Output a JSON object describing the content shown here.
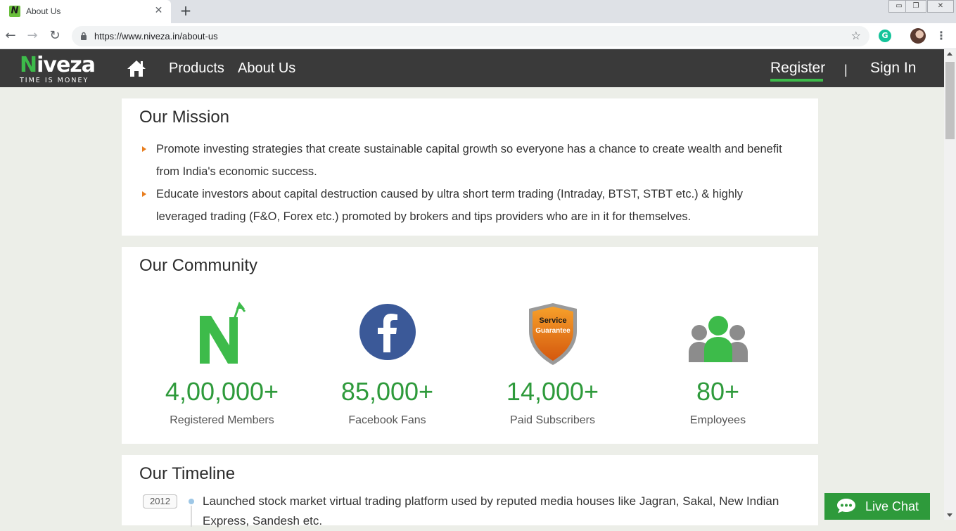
{
  "browser": {
    "tab_title": "About Us",
    "tab_favicon_letter": "N",
    "tab_close": "✕",
    "new_tab": "+",
    "url": "https://www.niveza.in/about-us",
    "controls": {
      "minimize": "▭",
      "restore": "❐",
      "close": "✕"
    }
  },
  "header": {
    "logo_first": "N",
    "logo_rest": "iveza",
    "logo_tagline": "TIME IS MONEY",
    "nav": [
      {
        "label": "Products"
      },
      {
        "label": "About Us"
      }
    ],
    "register_label": "Register",
    "separator": "|",
    "signin_label": "Sign In"
  },
  "mission": {
    "title": "Our Mission",
    "bullets": [
      "Promote investing strategies that create sustainable capital growth so everyone has a chance to create wealth and benefit from India's economic success.",
      "Educate investors about capital destruction caused by ultra short term trading (Intraday, BTST, STBT etc.) & highly leveraged trading (F&O, Forex etc.) promoted by brokers and tips providers who are in it for themselves."
    ]
  },
  "community": {
    "title": "Our Community",
    "stats": [
      {
        "icon": "niveza-n-icon",
        "value": "4,00,000+",
        "label": "Registered Members"
      },
      {
        "icon": "facebook-icon",
        "value": "85,000+",
        "label": "Facebook Fans"
      },
      {
        "icon": "service-guarantee-shield-icon",
        "value": "14,000+",
        "label": "Paid Subscribers",
        "badge_line1": "Service",
        "badge_line2": "Guarantee"
      },
      {
        "icon": "people-group-icon",
        "value": "80+",
        "label": "Employees"
      }
    ]
  },
  "timeline": {
    "title": "Our Timeline",
    "items": [
      {
        "year": "2012",
        "text": "Launched stock market virtual trading platform used by reputed media houses like Jagran, Sakal, New Indian Express, Sandesh etc."
      }
    ]
  },
  "live_chat": {
    "label": "Live Chat"
  },
  "colors": {
    "brand_green": "#2e9a3b",
    "logo_green": "#3dbb4a",
    "header_bg": "#3a3a3a",
    "bullet_orange": "#e87d1e",
    "facebook_blue": "#3b5998"
  }
}
